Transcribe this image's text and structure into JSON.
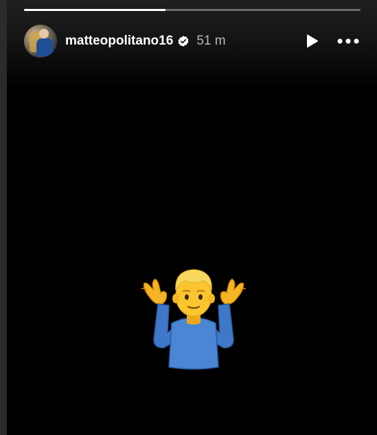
{
  "story": {
    "progress_fraction": 0.42,
    "username": "matteopolitano16",
    "timestamp": "51 m",
    "verified": true,
    "content_emoji": "person-shrugging"
  },
  "icons": {
    "play": "play-icon",
    "more": "more-options-icon",
    "verified": "verified-badge-icon"
  },
  "colors": {
    "background": "#000000",
    "progress_track": "#5a5a5a",
    "progress_fill": "#ffffff",
    "timestamp": "#b8b8b8"
  }
}
